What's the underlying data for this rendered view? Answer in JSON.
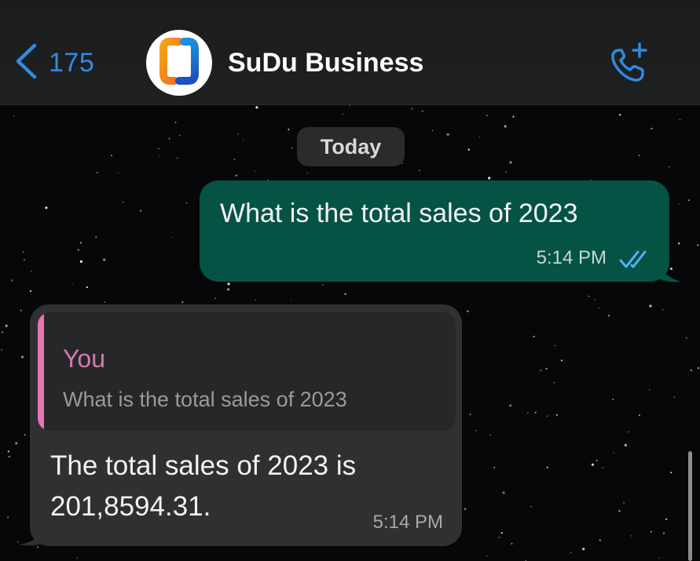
{
  "header": {
    "back_count": "175",
    "contact_name": "SuDu Business",
    "avatar_icon": "sudu-logo-icon",
    "back_icon": "chevron-left-icon",
    "call_icon": "add-call-icon"
  },
  "chat": {
    "date_label": "Today",
    "messages": [
      {
        "direction": "outgoing",
        "text": "What is the total sales of 2023",
        "time": "5:14 PM",
        "status_icon": "double-check-read-icon"
      },
      {
        "direction": "incoming",
        "quote": {
          "author": "You",
          "text": "What is the total sales of 2023"
        },
        "text": "The total sales of 2023 is 201,8594.31.",
        "time": "5:14 PM"
      }
    ]
  },
  "colors": {
    "accent": "#2f8be0",
    "outgoing_bubble": "#055345",
    "incoming_bubble": "#2f3032",
    "quote_bar": "#e873b4",
    "background": "#060708"
  }
}
